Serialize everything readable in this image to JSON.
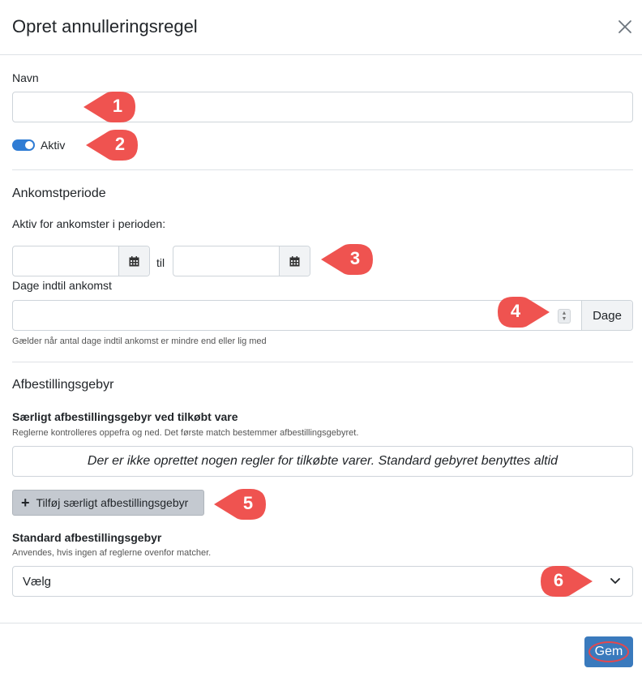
{
  "modal": {
    "title": "Opret annulleringsregel",
    "close_icon": "close-icon"
  },
  "name_field": {
    "label": "Navn",
    "value": "",
    "placeholder": ""
  },
  "active_toggle": {
    "label": "Aktiv",
    "checked": true,
    "color": "#2f7cd4"
  },
  "arrival_period": {
    "section_title": "Ankomstperiode",
    "period_label": "Aktiv for ankomster i perioden:",
    "from_value": "",
    "separator": "til",
    "to_value": "",
    "calendar_icon": "calendar-icon"
  },
  "days_until_arrival": {
    "label": "Dage indtil ankomst",
    "value": "",
    "addon": "Dage",
    "help": "Gælder når antal dage indtil ankomst er mindre end eller lig med"
  },
  "cancellation_fee": {
    "section_title": "Afbestillingsgebyr",
    "special_title": "Særligt afbestillingsgebyr ved tilkøbt vare",
    "special_help": "Reglerne kontrolleres oppefra og ned. Det første match bestemmer afbestillingsgebyret.",
    "empty_message": "Der er ikke oprettet nogen regler for tilkøbte varer. Standard gebyret benyttes altid",
    "add_button": "Tilføj særligt afbestillingsgebyr",
    "standard_title": "Standard afbestillingsgebyr",
    "standard_help": "Anvendes, hvis ingen af reglerne ovenfor matcher.",
    "select_value": "Vælg"
  },
  "footer": {
    "save_label": "Gem",
    "save_color": "#3a7abd"
  },
  "annotations": {
    "color": "#ef5350",
    "markers": [
      "1",
      "2",
      "3",
      "4",
      "5",
      "6"
    ]
  }
}
